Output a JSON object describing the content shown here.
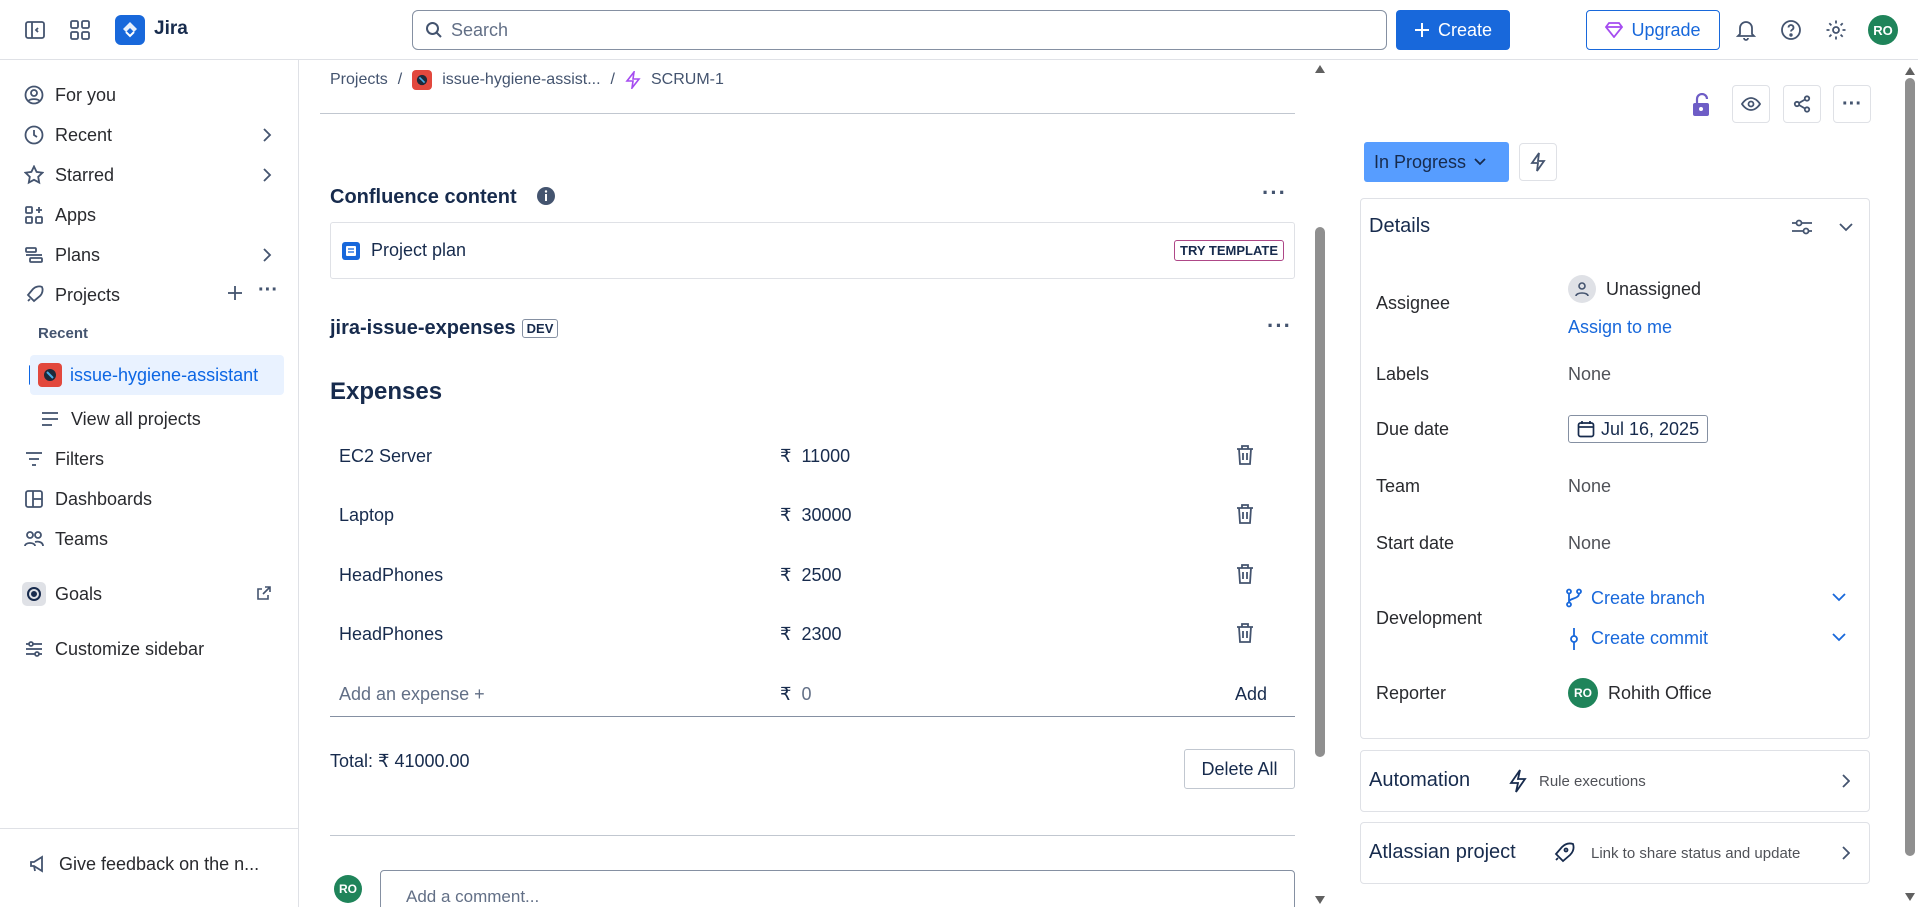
{
  "topbar": {
    "app_name": "Jira",
    "search_placeholder": "Search",
    "create_label": "Create",
    "upgrade_label": "Upgrade",
    "avatar_initials": "RO",
    "brand_color": "#1868db"
  },
  "sidebar": {
    "items": [
      {
        "label": "For you",
        "icon": "user-circle-icon"
      },
      {
        "label": "Recent",
        "icon": "clock-icon"
      },
      {
        "label": "Starred",
        "icon": "star-icon"
      },
      {
        "label": "Apps",
        "icon": "apps-icon"
      },
      {
        "label": "Plans",
        "icon": "plans-icon"
      },
      {
        "label": "Projects",
        "icon": "rocket-icon"
      }
    ],
    "recent_label": "Recent",
    "selected_project": "issue-hygiene-assistant",
    "view_all_projects": "View all projects",
    "filters": "Filters",
    "dashboards": "Dashboards",
    "teams": "Teams",
    "goals": "Goals",
    "customize": "Customize sidebar",
    "feedback": "Give feedback on the n..."
  },
  "breadcrumb": {
    "projects": "Projects",
    "project": "issue-hygiene-assist...",
    "issue": "SCRUM-1"
  },
  "confluence": {
    "title": "Confluence content",
    "item": "Project plan",
    "badge": "TRY TEMPLATE"
  },
  "app_section": {
    "title": "jira-issue-expenses",
    "badge": "DEV"
  },
  "expenses": {
    "heading": "Expenses",
    "currency": "₹",
    "rows": [
      {
        "name": "EC2 Server",
        "amount": "11000"
      },
      {
        "name": "Laptop",
        "amount": "30000"
      },
      {
        "name": "HeadPhones",
        "amount": "2500"
      },
      {
        "name": "HeadPhones",
        "amount": "2300"
      }
    ],
    "add_placeholder": "Add an expense +",
    "add_amount_placeholder": "0",
    "add_label": "Add",
    "total": "Total: ₹ 41000.00",
    "delete_all": "Delete All"
  },
  "comment": {
    "avatar": "RO",
    "placeholder": "Add a comment..."
  },
  "right": {
    "status": "In Progress",
    "details_title": "Details",
    "fields": {
      "assignee_label": "Assignee",
      "assignee_value": "Unassigned",
      "assign_to_me": "Assign to me",
      "labels_label": "Labels",
      "labels_value": "None",
      "due_label": "Due date",
      "due_value": "Jul 16, 2025",
      "team_label": "Team",
      "team_value": "None",
      "start_label": "Start date",
      "start_value": "None",
      "dev_label": "Development",
      "create_branch": "Create branch",
      "create_commit": "Create commit",
      "reporter_label": "Reporter",
      "reporter_initials": "RO",
      "reporter_name": "Rohith Office"
    },
    "automation_title": "Automation",
    "automation_sub": "Rule executions",
    "atlassian_title": "Atlassian project",
    "atlassian_sub": "Link to share status and update"
  }
}
